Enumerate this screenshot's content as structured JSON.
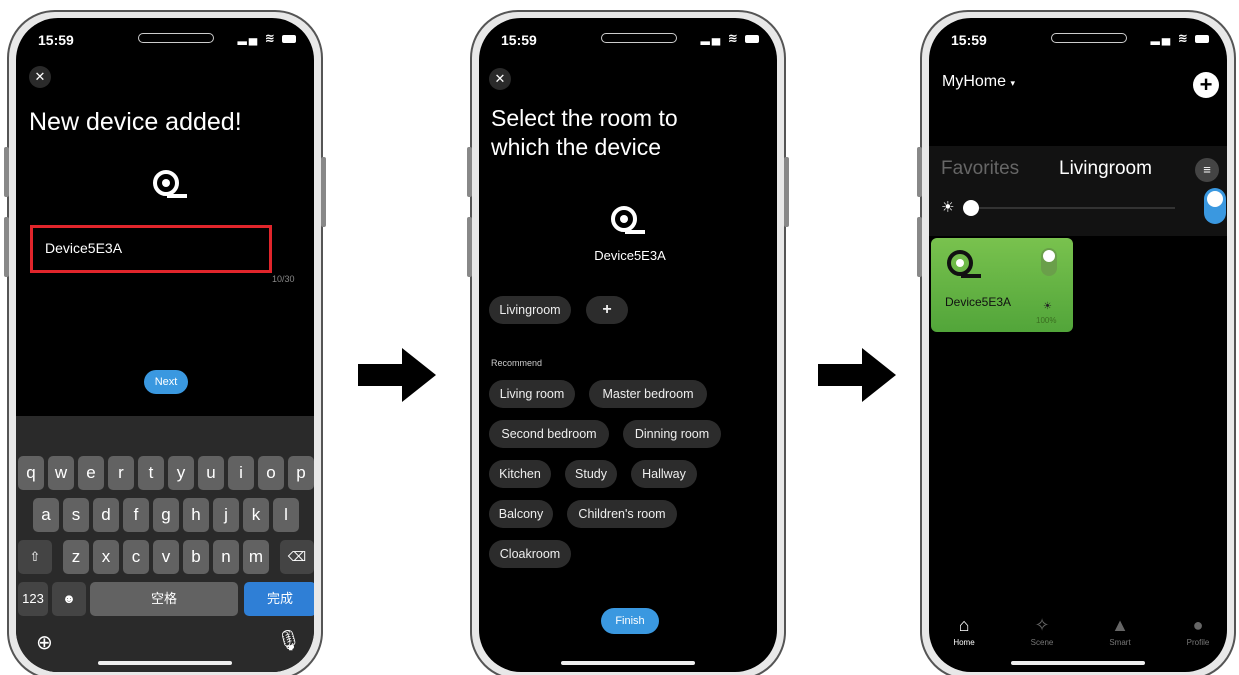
{
  "status": {
    "time": "15:59"
  },
  "screen1": {
    "title": "New device added!",
    "device_name_value": "Device5E3A",
    "counter": "10/30",
    "next_label": "Next",
    "keyboard": {
      "row1": [
        "q",
        "w",
        "e",
        "r",
        "t",
        "y",
        "u",
        "i",
        "o",
        "p"
      ],
      "row2": [
        "a",
        "s",
        "d",
        "f",
        "g",
        "h",
        "j",
        "k",
        "l"
      ],
      "row3": [
        "z",
        "x",
        "c",
        "v",
        "b",
        "n",
        "m"
      ],
      "num_key": "123",
      "space_key": "空格",
      "done_key": "完成"
    }
  },
  "screen2": {
    "title": "Select the room to which the device",
    "device_name": "Device5E3A",
    "selected_room": "Livingroom",
    "add_label": "+",
    "recommend_label": "Recommend",
    "rooms": [
      "Living room",
      "Master bedroom",
      "Second bedroom",
      "Dinning room",
      "Kitchen",
      "Study",
      "Hallway",
      "Balcony",
      "Children's room",
      "Cloakroom"
    ],
    "finish_label": "Finish"
  },
  "screen3": {
    "home_name": "MyHome",
    "tabs": [
      "Favorites",
      "Livingroom"
    ],
    "card": {
      "name": "Device5E3A",
      "brightness": "100%"
    },
    "nav": [
      "Home",
      "Scene",
      "Smart",
      "Profile"
    ]
  },
  "colors": {
    "accent": "#3a98e0",
    "highlight_box": "#e0252b",
    "card_green": "#6bbb45"
  },
  "icons": [
    "close-icon",
    "device-reel-icon",
    "globe-icon",
    "microphone-icon",
    "shift-icon",
    "delete-icon",
    "emoji-icon",
    "plus-icon",
    "menu-icon",
    "sun-icon",
    "home-icon",
    "scene-icon",
    "smart-icon",
    "profile-icon",
    "arrow-right-icon"
  ]
}
